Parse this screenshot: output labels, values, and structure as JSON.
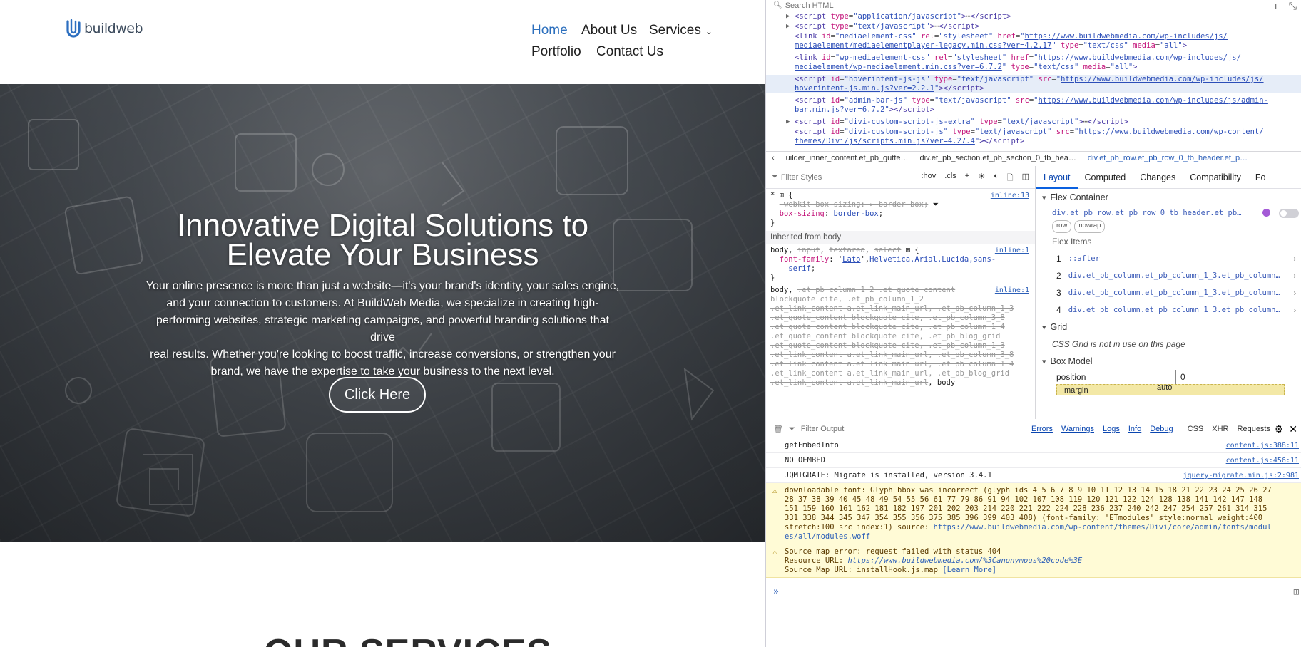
{
  "site": {
    "logo_text": "buildweb",
    "nav": [
      "Home",
      "About Us",
      "Services",
      "Portfolio",
      "Contact Us"
    ],
    "services_chevron": "chevron-down-icon",
    "hero": {
      "title_line1": "Innovative Digital Solutions to",
      "title_line2": "Elevate Your Business",
      "body_lines": [
        "Your online presence is more than just a website—it's your brand's identity, your sales engine,",
        "and your connection to customers. At BuildWeb Media, we specialize in creating high-",
        "performing websites, strategic marketing campaigns, and powerful branding solutions that drive",
        "real results. Whether you're looking to boost traffic, increase conversions, or strengthen your",
        "brand, we have the expertise to take your business to the next level."
      ],
      "cta": "Click Here"
    },
    "services_heading": "OUR SERVICES"
  },
  "devtools": {
    "search_placeholder": "Search HTML",
    "breadcrumbs": [
      "uilder_inner_content.et_pb_gutte…",
      "div.et_pb_section.et_pb_section_0_tb_hea…",
      "div.et_pb_row.et_pb_row_0_tb_header.et_p…"
    ],
    "filter_styles": "Filter Styles",
    "hov": ":hov",
    "cls": ".cls",
    "inherited": "Inherited from body",
    "layout_tabs": [
      "Layout",
      "Computed",
      "Changes",
      "Compatibility",
      "Fo"
    ],
    "flex_container": "Flex Container",
    "flex_selector": "div.et_pb_row.et_pb_row_0_tb_header.et_pb…",
    "pills": [
      "row",
      "nowrap"
    ],
    "flex_items_label": "Flex Items",
    "flex_items": [
      {
        "n": "1",
        "sel": "::after"
      },
      {
        "n": "2",
        "sel": "div.et_pb_column.et_pb_column_1_3.et_pb_column…"
      },
      {
        "n": "3",
        "sel": "div.et_pb_column.et_pb_column_1_3.et_pb_column…"
      },
      {
        "n": "4",
        "sel": "div.et_pb_column.et_pb_column_1_3.et_pb_column…"
      }
    ],
    "grid_label": "Grid",
    "grid_note": "CSS Grid is not in use on this page",
    "box_model_label": "Box Model",
    "position_label": "position",
    "position_value": "0",
    "margin_label": "margin",
    "margin_value": "auto",
    "console_filter": "Filter Output",
    "console_cats": [
      "Errors",
      "Warnings",
      "Logs",
      "Info",
      "Debug",
      "CSS",
      "XHR",
      "Requests"
    ],
    "console": [
      {
        "text": "getEmbedInfo",
        "loc": "content.js:388:11"
      },
      {
        "text": "NO OEMBED",
        "loc": "content.js:456:11"
      },
      {
        "text": "JQMIGRATE: Migrate is installed, version 3.4.1",
        "loc": "jquery-migrate.min.js:2:981"
      }
    ]
  }
}
